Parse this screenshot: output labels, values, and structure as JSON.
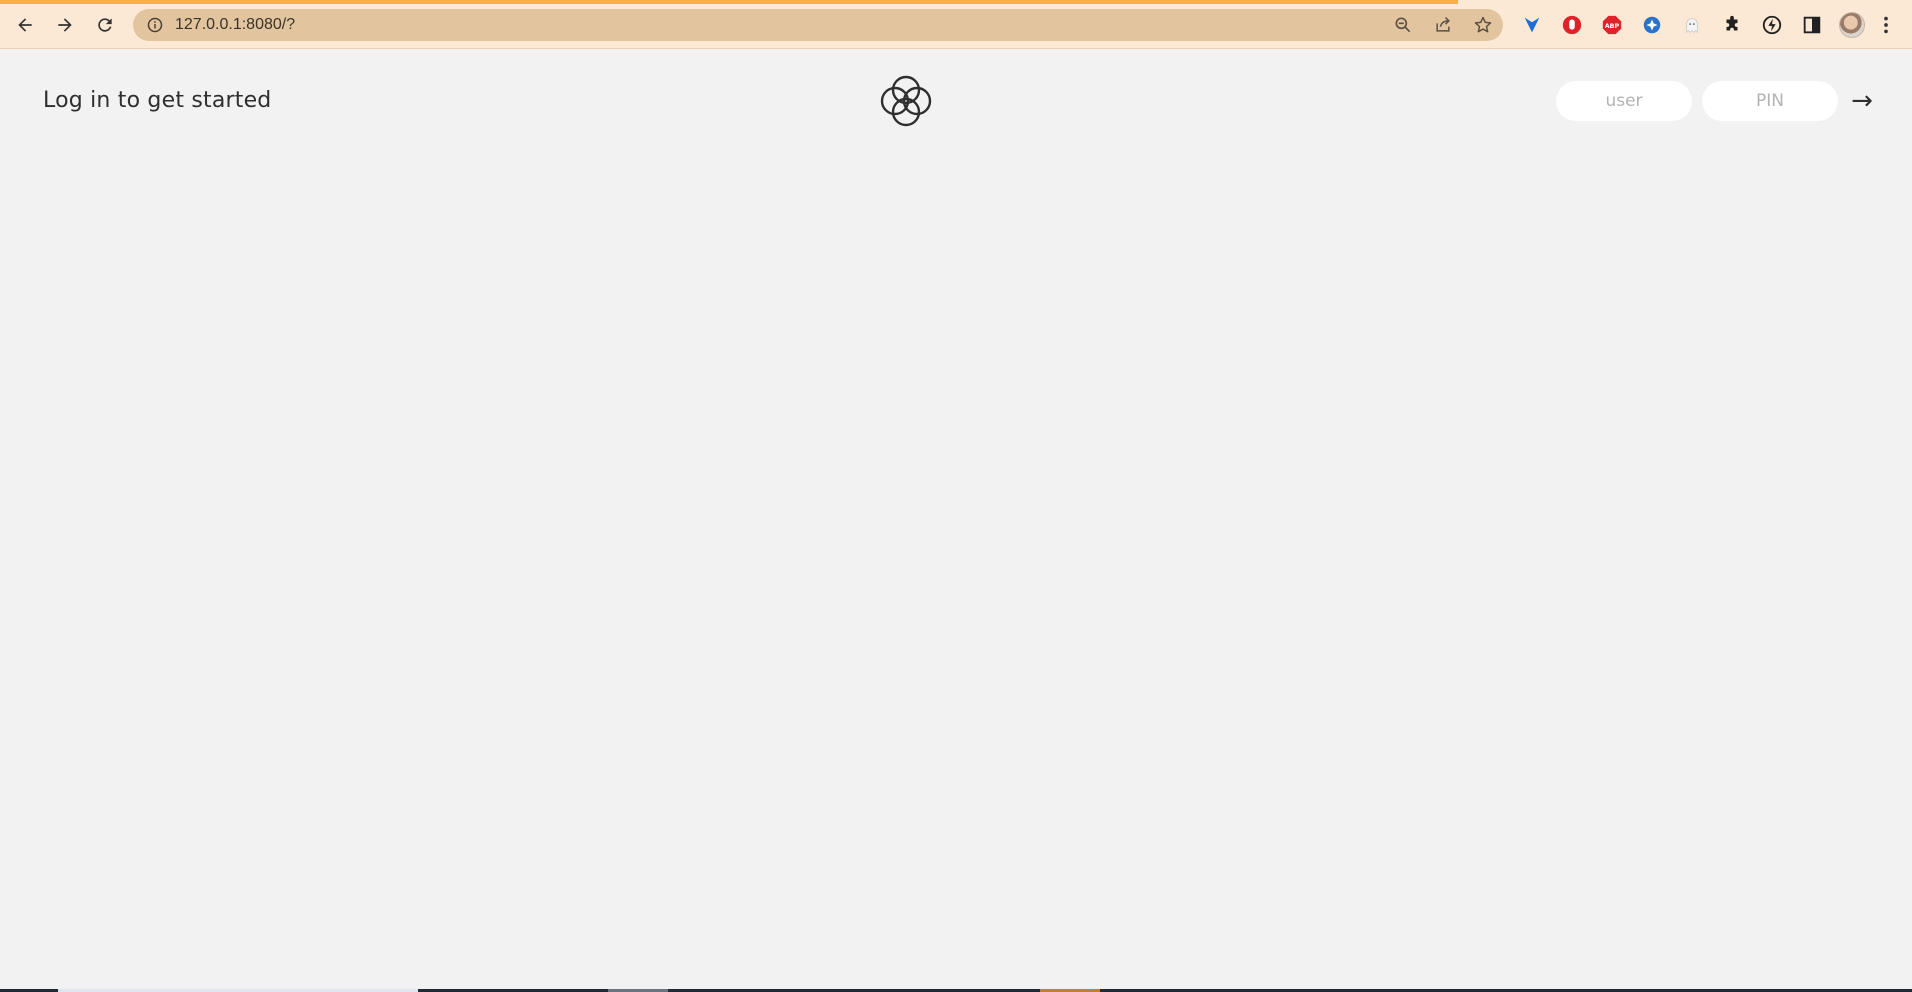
{
  "browser": {
    "url": "127.0.0.1:8080/?",
    "accent_color": "#f7b046",
    "toolbar_icons": [
      "back-icon",
      "forward-icon",
      "reload-icon",
      "info-icon",
      "zoom-icon",
      "share-icon",
      "bookmark-star-icon"
    ],
    "extensions": [
      "dashlane-heart-icon",
      "ublock-hand-icon",
      "adblock-plus-icon",
      "blue-extension-icon",
      "ghost-extension-icon",
      "puzzle-extensions-icon",
      "lightning-extension-icon",
      "side-panel-icon",
      "profile-avatar",
      "menu-kebab-icon"
    ]
  },
  "header": {
    "title": "Log in to get started",
    "logo": "four-rings-logo"
  },
  "login": {
    "user_placeholder": "user",
    "pin_placeholder": "PIN",
    "submit_label": "→"
  }
}
